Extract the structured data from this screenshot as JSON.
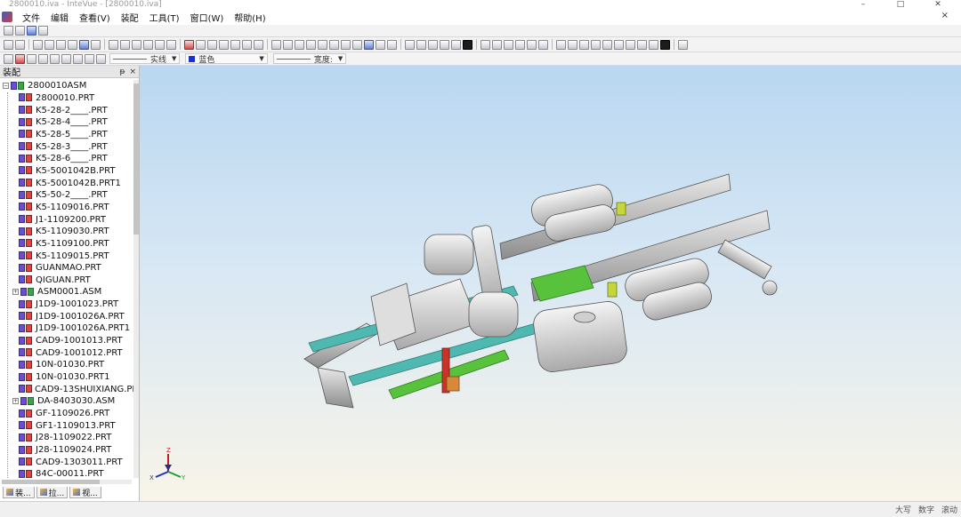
{
  "window": {
    "title": "2800010.iva - InteVue - [2800010.iva]",
    "controls": [
      "–",
      "□",
      "✕"
    ]
  },
  "menu": {
    "items": [
      "文件",
      "编辑",
      "查看(V)",
      "装配",
      "工具(T)",
      "窗口(W)",
      "帮助(H)"
    ],
    "doc_close": "×"
  },
  "toolbar3": {
    "line_style": "实线",
    "color_label": "蓝色",
    "color_hex": "#1a2fd8",
    "width_label": "宽度:"
  },
  "panel": {
    "title": "装配",
    "pin": "ᵽ",
    "close": "×",
    "root": "2800010ASM",
    "items": [
      {
        "label": "2800010.PRT",
        "type": "prt"
      },
      {
        "label": "K5-28-2____.PRT",
        "type": "prt"
      },
      {
        "label": "K5-28-4____.PRT",
        "type": "prt"
      },
      {
        "label": "K5-28-5____.PRT",
        "type": "prt"
      },
      {
        "label": "K5-28-3____.PRT",
        "type": "prt"
      },
      {
        "label": "K5-28-6____.PRT",
        "type": "prt"
      },
      {
        "label": "K5-5001042B.PRT",
        "type": "prt"
      },
      {
        "label": "K5-5001042B.PRT1",
        "type": "prt"
      },
      {
        "label": "K5-50-2____.PRT",
        "type": "prt"
      },
      {
        "label": "K5-1109016.PRT",
        "type": "prt"
      },
      {
        "label": "J1-1109200.PRT",
        "type": "prt"
      },
      {
        "label": "K5-1109030.PRT",
        "type": "prt"
      },
      {
        "label": "K5-1109100.PRT",
        "type": "prt"
      },
      {
        "label": "K5-1109015.PRT",
        "type": "prt"
      },
      {
        "label": "GUANMAO.PRT",
        "type": "prt"
      },
      {
        "label": "QIGUAN.PRT",
        "type": "prt"
      },
      {
        "label": "ASM0001.ASM",
        "type": "asm"
      },
      {
        "label": "J1D9-1001023.PRT",
        "type": "prt"
      },
      {
        "label": "J1D9-1001026A.PRT",
        "type": "prt"
      },
      {
        "label": "J1D9-1001026A.PRT1",
        "type": "prt"
      },
      {
        "label": "CAD9-1001013.PRT",
        "type": "prt"
      },
      {
        "label": "CAD9-1001012.PRT",
        "type": "prt"
      },
      {
        "label": "10N-01030.PRT",
        "type": "prt"
      },
      {
        "label": "10N-01030.PRT1",
        "type": "prt"
      },
      {
        "label": "CAD9-13SHUIXIANG.PF",
        "type": "prt"
      },
      {
        "label": "DA-8403030.ASM",
        "type": "asm"
      },
      {
        "label": "GF-1109026.PRT",
        "type": "prt"
      },
      {
        "label": "GF1-1109013.PRT",
        "type": "prt"
      },
      {
        "label": "J28-1109022.PRT",
        "type": "prt"
      },
      {
        "label": "J28-1109024.PRT",
        "type": "prt"
      },
      {
        "label": "CAD9-1303011.PRT",
        "type": "prt"
      },
      {
        "label": "84C-00011.PRT",
        "type": "prt"
      }
    ],
    "tabs": [
      "装...",
      "拉...",
      "视..."
    ]
  },
  "viewport": {
    "axis": {
      "x": "X",
      "y": "Y",
      "z": "Z"
    }
  },
  "status": {
    "caps": "大写",
    "num": "数字",
    "scroll": "滚动"
  }
}
